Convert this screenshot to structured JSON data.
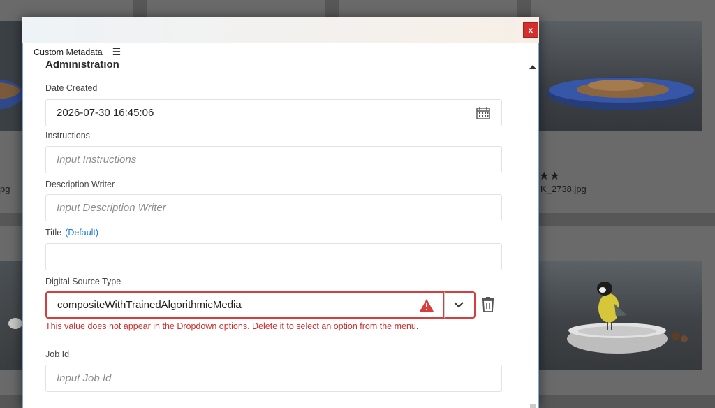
{
  "background": {
    "files": [
      {
        "name_fragment": "pg"
      },
      {
        "name_fragment": "K_2738.jpg",
        "rating_text": "★★"
      }
    ]
  },
  "dialog": {
    "close_label": "x",
    "panel_tab_label": "Custom Metadata",
    "panel_menu_icon": "hamburger-icon",
    "section_title": "Administration",
    "fields": {
      "date_created": {
        "label": "Date Created",
        "value": "2026-07-30 16:45:06",
        "icon": "calendar-icon"
      },
      "instructions": {
        "label": "Instructions",
        "placeholder": "Input Instructions"
      },
      "description_writer": {
        "label": "Description Writer",
        "placeholder": "Input Description Writer"
      },
      "title": {
        "label": "Title",
        "default_tag": "(Default)",
        "value": ""
      },
      "digital_source_type": {
        "label": "Digital Source Type",
        "value": "compositeWithTrainedAlgorithmicMedia",
        "error": "This value does not appear in the Dropdown options. Delete it to select an option from the menu.",
        "status_icon": "warning-icon",
        "dropdown_icon": "chevron-down-icon",
        "delete_icon": "trash-icon"
      },
      "job_id": {
        "label": "Job Id",
        "placeholder": "Input Job Id"
      }
    }
  },
  "colors": {
    "error": "#d73d3d",
    "link": "#1473e6",
    "close": "#d3302d"
  }
}
